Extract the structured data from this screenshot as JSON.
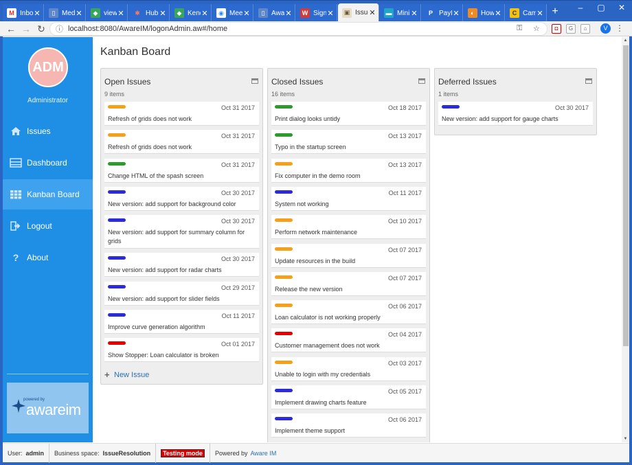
{
  "browser": {
    "tabs": [
      {
        "label": "Inbox",
        "fav": "M",
        "color": "#ffffff",
        "fg": "#d93025"
      },
      {
        "label": "Medi",
        "fav": "▯",
        "color": "#5f87c9",
        "fg": "#ffffff"
      },
      {
        "label": "views",
        "fav": "◆",
        "color": "#3aa55d",
        "fg": "#ffffff"
      },
      {
        "label": "HubS",
        "fav": "✱",
        "color": "#2d6ad0",
        "fg": "#ff7a59"
      },
      {
        "label": "Kendo",
        "fav": "◆",
        "color": "#3aa55d",
        "fg": "#ffffff"
      },
      {
        "label": "Meet",
        "fav": "◉",
        "color": "#ffffff",
        "fg": "#2d8cff"
      },
      {
        "label": "Aware",
        "fav": "▯",
        "color": "#5f87c9",
        "fg": "#ffffff"
      },
      {
        "label": "Sign",
        "fav": "W",
        "color": "#d13b3b",
        "fg": "#ffffff"
      },
      {
        "label": "Issue",
        "fav": "▣",
        "color": "#e7dcc7",
        "fg": "#6a5a3a"
      },
      {
        "label": "Mini",
        "fav": "▬",
        "color": "#1fa5c7",
        "fg": "#ffffff"
      },
      {
        "label": "PayP",
        "fav": "P",
        "color": "#2d6ad0",
        "fg": "#ffffff"
      },
      {
        "label": "How",
        "fav": "◐",
        "color": "#f08a24",
        "fg": "#ffffff"
      },
      {
        "label": "Camp",
        "fav": "C",
        "color": "#f4c20d",
        "fg": "#333333"
      }
    ],
    "active_tab": 8,
    "url": "localhost:8080/AwareIM/logonAdmin.aw#/home",
    "profile_initial": "V"
  },
  "sidebar": {
    "avatar_initials": "ADM",
    "user_name": "Administrator",
    "items": [
      {
        "label": "Issues",
        "icon": "home-icon"
      },
      {
        "label": "Dashboard",
        "icon": "dashboard-icon"
      },
      {
        "label": "Kanban Board",
        "icon": "grid-icon"
      },
      {
        "label": "Logout",
        "icon": "logout-icon"
      },
      {
        "label": "About",
        "icon": "question-icon"
      }
    ],
    "active_index": 2,
    "logo_small": "powered by",
    "logo_text": "awareim"
  },
  "main": {
    "title": "Kanban Board",
    "new_issue_label": "New Issue",
    "columns": [
      {
        "title": "Open Issues",
        "count": "9 items",
        "cards": [
          {
            "color": "#f5a01a",
            "date": "Oct 31 2017",
            "title": "Refresh of grids does not work"
          },
          {
            "color": "#f5a01a",
            "date": "Oct 31 2017",
            "title": "Refresh of grids does not work"
          },
          {
            "color": "#2e9a2e",
            "date": "Oct 31 2017",
            "title": "Change HTML of the spash screen"
          },
          {
            "color": "#2b2bd9",
            "date": "Oct 30 2017",
            "title": "New version: add support for background color"
          },
          {
            "color": "#2b2bd9",
            "date": "Oct 30 2017",
            "title": "New version: add support for summary column for grids"
          },
          {
            "color": "#2b2bd9",
            "date": "Oct 30 2017",
            "title": "New version: add support for radar charts"
          },
          {
            "color": "#2b2bd9",
            "date": "Oct 29 2017",
            "title": "New version: add support for slider fields"
          },
          {
            "color": "#2b2bd9",
            "date": "Oct 11 2017",
            "title": "Improve curve generation algorithm"
          },
          {
            "color": "#e60000",
            "date": "Oct 01 2017",
            "title": "Show Stopper: Loan calculator is broken"
          }
        ]
      },
      {
        "title": "Closed Issues",
        "count": "16 items",
        "cards": [
          {
            "color": "#2e9a2e",
            "date": "Oct 18 2017",
            "title": "Print dialog looks untidy"
          },
          {
            "color": "#2e9a2e",
            "date": "Oct 13 2017",
            "title": "Typo in the startup screen"
          },
          {
            "color": "#f5a01a",
            "date": "Oct 13 2017",
            "title": "Fix computer in the demo room"
          },
          {
            "color": "#2b2bd9",
            "date": "Oct 11 2017",
            "title": "System not working"
          },
          {
            "color": "#f5a01a",
            "date": "Oct 10 2017",
            "title": "Perform network maintenance"
          },
          {
            "color": "#f5a01a",
            "date": "Oct 07 2017",
            "title": "Update resources in the build"
          },
          {
            "color": "#f5a01a",
            "date": "Oct 07 2017",
            "title": "Release the new version"
          },
          {
            "color": "#f5a01a",
            "date": "Oct 06 2017",
            "title": "Loan calculator is not working properly"
          },
          {
            "color": "#e60000",
            "date": "Oct 04 2017",
            "title": "Customer management does not work"
          },
          {
            "color": "#f5a01a",
            "date": "Oct 03 2017",
            "title": "Unable to login with my credentials"
          },
          {
            "color": "#2b2bd9",
            "date": "Oct 05 2017",
            "title": "Implement drawing charts feature"
          },
          {
            "color": "#2b2bd9",
            "date": "Oct 06 2017",
            "title": "Implement theme support"
          }
        ]
      },
      {
        "title": "Deferred Issues",
        "count": "1 items",
        "cards": [
          {
            "color": "#2b2bd9",
            "date": "Oct 30 2017",
            "title": "New version: add support for gauge charts"
          }
        ]
      }
    ]
  },
  "status": {
    "user_label": "User:",
    "user_value": "admin",
    "space_label": "Business space:",
    "space_value": "IssueResolution",
    "testing_label": "Testing mode",
    "powered_label": "Powered by",
    "powered_link": "Aware IM"
  }
}
